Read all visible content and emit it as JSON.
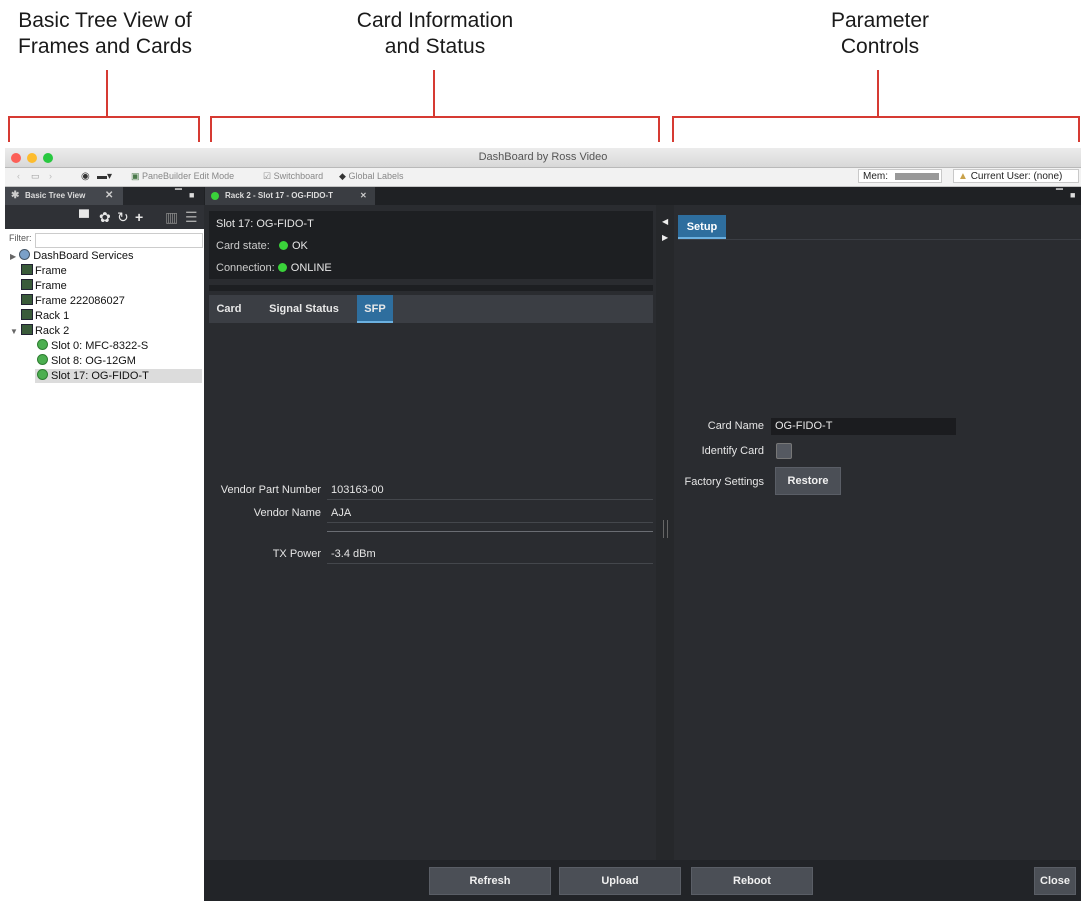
{
  "annotations": {
    "left_title": "Basic Tree View of\nFrames and Cards",
    "center_title": "Card Information\nand Status",
    "right_title": "Parameter\nControls"
  },
  "window": {
    "title": "DashBoard by Ross Video"
  },
  "toolbar": {
    "panelbuilder_label": "PaneBuilder Edit Mode",
    "switchboard_label": "Switchboard",
    "global_labels_label": "Global Labels",
    "mem_label": "Mem:",
    "current_user": "Current User: (none)"
  },
  "left_panel": {
    "tab_label": "Basic Tree View",
    "filter_label": "Filter:",
    "tree": [
      {
        "label": "DashBoard Services"
      },
      {
        "label": "Frame"
      },
      {
        "label": "Frame"
      },
      {
        "label": "Frame 222086027"
      },
      {
        "label": "Rack 1"
      },
      {
        "label": "Rack 2"
      },
      {
        "label": "Slot 0: MFC-8322-S"
      },
      {
        "label": "Slot 8: OG-12GM"
      },
      {
        "label": "Slot 17: OG-FIDO-T"
      }
    ]
  },
  "center_tab": {
    "label": "Rack 2 - Slot 17 - OG-FIDO-T"
  },
  "card_info": {
    "slot_title": "Slot 17: OG-FIDO-T",
    "card_state_label": "Card state:",
    "card_state_value": "OK",
    "connection_label": "Connection:",
    "connection_value": "ONLINE"
  },
  "subtabs": {
    "card": "Card",
    "signal_status": "Signal Status",
    "sfp": "SFP"
  },
  "sfp": {
    "vendor_part_label": "Vendor Part Number",
    "vendor_part_value": "103163-00",
    "vendor_name_label": "Vendor Name",
    "vendor_name_value": "AJA",
    "tx_power_label": "TX Power",
    "tx_power_value": "-3.4 dBm"
  },
  "setup": {
    "tab_label": "Setup",
    "card_name_label": "Card Name",
    "card_name_value": "OG-FIDO-T",
    "identify_label": "Identify Card",
    "identify_checked": false,
    "factory_label": "Factory Settings",
    "restore_label": "Restore"
  },
  "bottom": {
    "refresh": "Refresh",
    "upload": "Upload",
    "reboot": "Reboot",
    "close": "Close"
  },
  "colors": {
    "annotation_red": "#d63a32",
    "active_tab_blue": "#2e6e9e",
    "status_green": "#3ad23a"
  }
}
